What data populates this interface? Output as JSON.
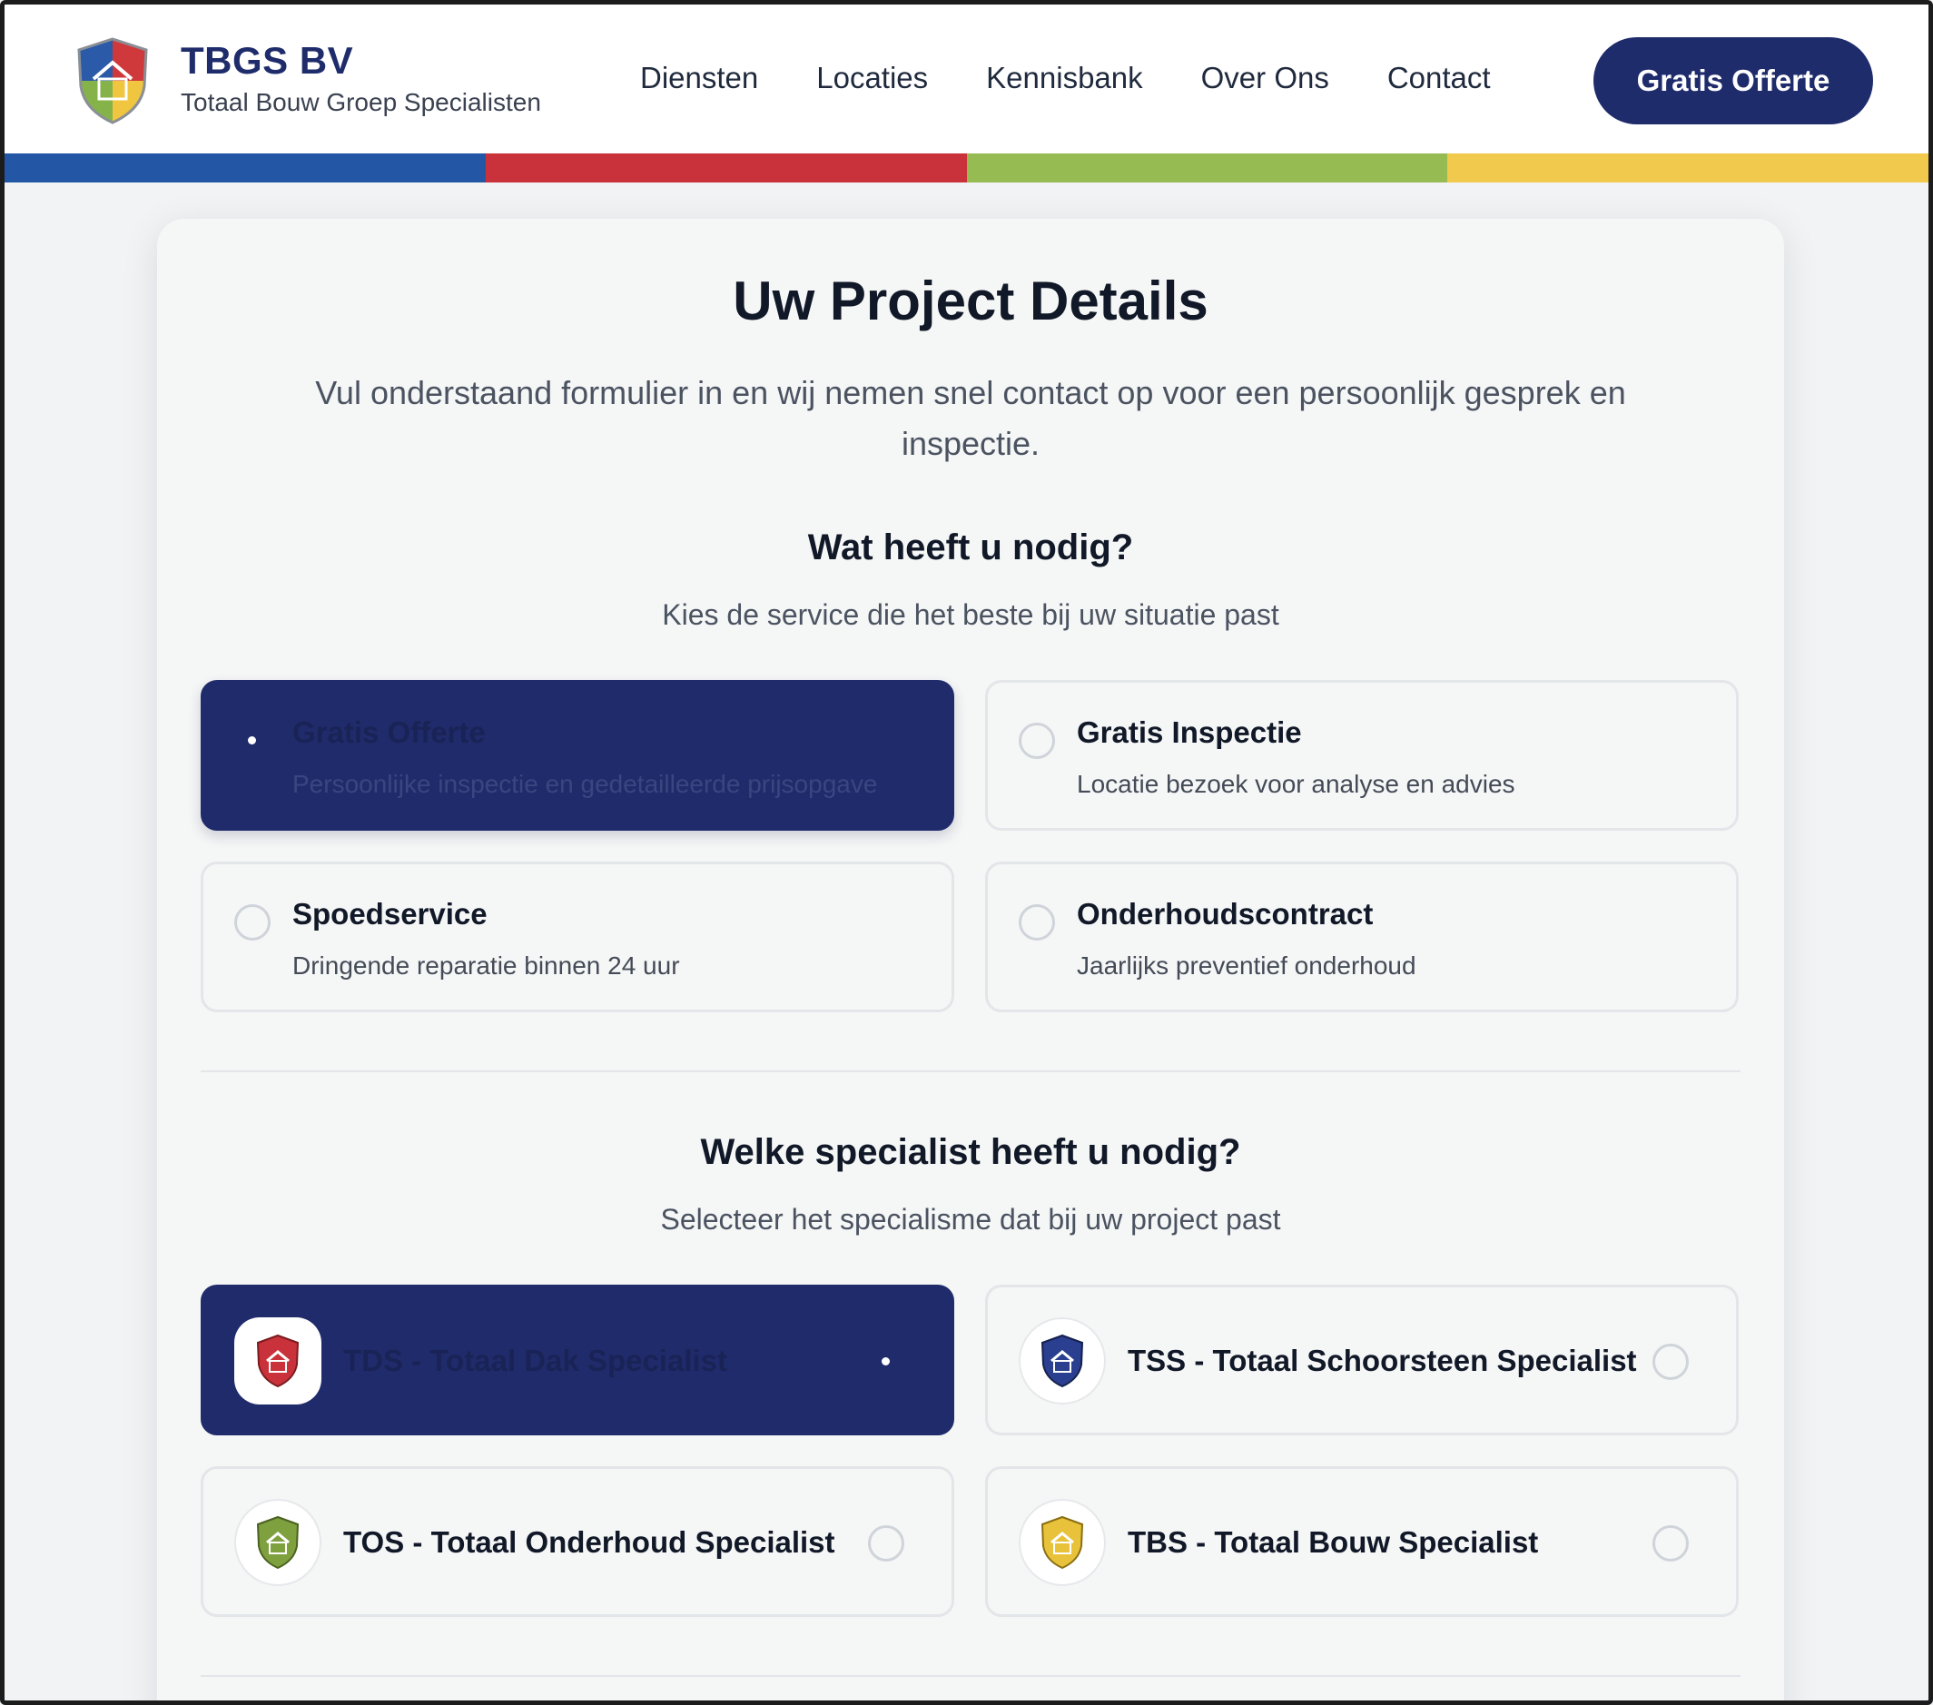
{
  "header": {
    "brand_title": "TBGS BV",
    "brand_subtitle": "Totaal Bouw Groep Specialisten",
    "logo_icon": "shield-house-logo",
    "nav": [
      "Diensten",
      "Locaties",
      "Kennisbank",
      "Over Ons",
      "Contact"
    ],
    "cta_label": "Gratis Offerte",
    "stripe_colors": [
      "#2357a6",
      "#c9323a",
      "#95bb52",
      "#f1c94d"
    ]
  },
  "form": {
    "title": "Uw Project Details",
    "subtitle": "Vul onderstaand formulier in en wij nemen snel contact op voor een persoonlijk gesprek en inspectie.",
    "service_section": {
      "title": "Wat heeft u nodig?",
      "subtitle": "Kies de service die het beste bij uw situatie past",
      "options": [
        {
          "title": "Gratis Offerte",
          "desc": "Persoonlijke inspectie en gedetailleerde prijsopgave",
          "selected": true
        },
        {
          "title": "Gratis Inspectie",
          "desc": "Locatie bezoek voor analyse en advies",
          "selected": false
        },
        {
          "title": "Spoedservice",
          "desc": "Dringende reparatie binnen 24 uur",
          "selected": false
        },
        {
          "title": "Onderhoudscontract",
          "desc": "Jaarlijks preventief onderhoud",
          "selected": false
        }
      ]
    },
    "specialist_section": {
      "title": "Welke specialist heeft u nodig?",
      "subtitle": "Selecteer het specialisme dat bij uw project past",
      "options": [
        {
          "label": "TDS - Totaal Dak Specialist",
          "icon": "red-shield-icon",
          "color": "#c9323a",
          "selected": true
        },
        {
          "label": "TSS - Totaal Schoorsteen Specialist",
          "icon": "blue-shield-icon",
          "color": "#2a3f8f",
          "selected": false
        },
        {
          "label": "TOS - Totaal Onderhoud Specialist",
          "icon": "green-shield-icon",
          "color": "#7fa03f",
          "selected": false
        },
        {
          "label": "TBS - Totaal Bouw Specialist",
          "icon": "yellow-shield-icon",
          "color": "#e8c23a",
          "selected": false
        }
      ]
    }
  }
}
